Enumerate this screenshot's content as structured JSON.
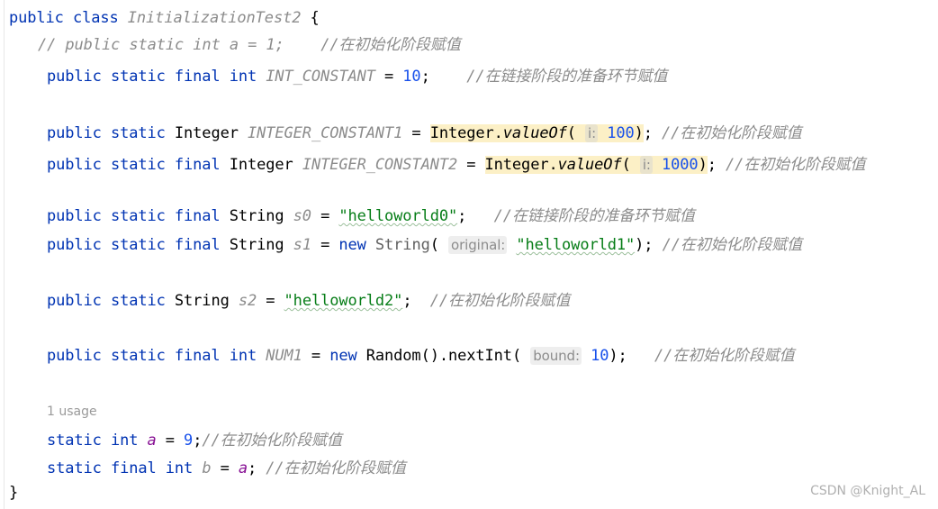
{
  "editor": {
    "language": "java",
    "theme": "intellij-light",
    "background_color": "#ffffff",
    "highlight_color": "#fcf0c6",
    "hint_chip_color": "#eeeeee",
    "keyword_color": "#0033b3",
    "string_color": "#067d17",
    "number_color": "#1750eb",
    "comment_color": "#8c8c8c",
    "field_purple_color": "#871094"
  },
  "lines": {
    "l1": {
      "kw_public": "public",
      "sp1": " ",
      "kw_class": "class",
      "sp2": " ",
      "class_name": "InitializationTest2",
      "sp3": " ",
      "brace": "{"
    },
    "l2": {
      "comment": "// public static int a = 1;",
      "gap": "    ",
      "cn_comment": "//在初始化阶段赋值"
    },
    "l3": {
      "kw": "public static final int",
      "sp1": " ",
      "field": "INT_CONSTANT",
      "eq": " = ",
      "value": "10",
      "semi": ";",
      "gap": "    ",
      "cn_comment": "//在链接阶段的准备环节赋值"
    },
    "l5": {
      "kw1": "public static",
      "sp1": " ",
      "type": "Integer",
      "sp2": " ",
      "field": "INTEGER_CONSTANT1",
      "eq": " = ",
      "call_type": "Integer",
      "dot": ".",
      "call_method": "valueOf",
      "paren_open": "( ",
      "param_hint": "i:",
      "sp3": " ",
      "value": "100",
      "paren_close": ")",
      "semi": ";",
      "gap": " ",
      "cn_comment": "//在初始化阶段赋值"
    },
    "l6": {
      "kw1": "public static final",
      "sp1": " ",
      "type": "Integer",
      "sp2": " ",
      "field": "INTEGER_CONSTANT2",
      "eq": " = ",
      "call_type": "Integer",
      "dot": ".",
      "call_method": "valueOf",
      "paren_open": "( ",
      "param_hint": "i:",
      "sp3": " ",
      "value": "1000",
      "paren_close": ")",
      "semi": ";",
      "gap": " ",
      "cn_comment": "//在初始化阶段赋值"
    },
    "l8": {
      "kw1": "public static final",
      "sp1": " ",
      "type": "String",
      "sp2": " ",
      "field": "s0",
      "eq": " = ",
      "value": "\"helloworld0\"",
      "semi": ";",
      "gap": "   ",
      "cn_comment": "//在链接阶段的准备环节赋值"
    },
    "l9": {
      "kw1": "public static final",
      "sp1": " ",
      "type": "String",
      "sp2": " ",
      "field": "s1",
      "eq": " = ",
      "kw_new": "new",
      "sp3": " ",
      "ctor": "String",
      "paren_open": "( ",
      "param_hint": "original:",
      "sp4": " ",
      "value": "\"helloworld1\"",
      "paren_close": ")",
      "semi": ";",
      "gap": " ",
      "cn_comment": "//在初始化阶段赋值"
    },
    "l11": {
      "kw1": "public static",
      "sp1": " ",
      "type": "String",
      "sp2": " ",
      "field": "s2",
      "eq": " = ",
      "value": "\"helloworld2\"",
      "semi": ";",
      "gap": "  ",
      "cn_comment": "//在初始化阶段赋值"
    },
    "l13": {
      "kw1": "public static final int",
      "sp1": " ",
      "field": "NUM1",
      "eq": " = ",
      "kw_new": "new",
      "sp2": " ",
      "ctor": "Random",
      "parens": "()",
      "dot": ".",
      "method": "nextInt",
      "paren_open": "( ",
      "param_hint": "bound:",
      "sp3": " ",
      "value": "10",
      "paren_close": ")",
      "semi": ";",
      "gap": "   ",
      "cn_comment": "//在初始化阶段赋值"
    },
    "usage_hint": "1 usage",
    "l15": {
      "kw1": "static int",
      "sp1": " ",
      "field": "a",
      "eq": " = ",
      "value": "9",
      "semi": ";",
      "cn_comment": "//在初始化阶段赋值"
    },
    "l16": {
      "kw1": "static final int",
      "sp1": " ",
      "field": "b",
      "eq": " = ",
      "ref": "a",
      "semi": ";",
      "gap": " ",
      "cn_comment": "//在初始化阶段赋值"
    },
    "l17": {
      "brace": "}"
    }
  },
  "watermark": {
    "text": "CSDN @Knight_AL"
  }
}
